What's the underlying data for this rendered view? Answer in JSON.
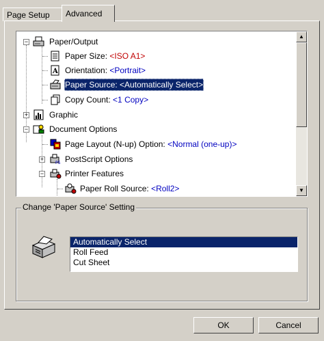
{
  "tabs": [
    {
      "label": "Page Setup",
      "active": false
    },
    {
      "label": "Advanced",
      "active": true
    }
  ],
  "tree": {
    "paper_output": "Paper/Output",
    "paper_size": {
      "label": "Paper Size: ",
      "value": "<ISO A1>"
    },
    "orientation": {
      "label": "Orientation: ",
      "value": "<Portrait>"
    },
    "paper_source": {
      "label": "Paper Source: ",
      "value": "<Automatically Select>"
    },
    "copy_count": {
      "label": "Copy Count: ",
      "value": "<1 Copy>"
    },
    "graphic": "Graphic",
    "document_options": "Document Options",
    "page_layout": {
      "label": "Page Layout (N-up) Option: ",
      "value": "<Normal (one-up)>"
    },
    "postscript_options": "PostScript Options",
    "printer_features": "Printer Features",
    "paper_roll_source": {
      "label": "Paper Roll Source: ",
      "value": "<Roll2>"
    }
  },
  "setting_group": {
    "title": "Change 'Paper Source' Setting",
    "options": [
      "Automatically Select",
      "Roll Feed",
      "Cut Sheet"
    ],
    "selected": "Automatically Select"
  },
  "buttons": {
    "ok": "OK",
    "cancel": "Cancel"
  },
  "colors": {
    "selection": "#0a246a",
    "value_blue": "#0000c0",
    "value_red": "#c00000"
  }
}
